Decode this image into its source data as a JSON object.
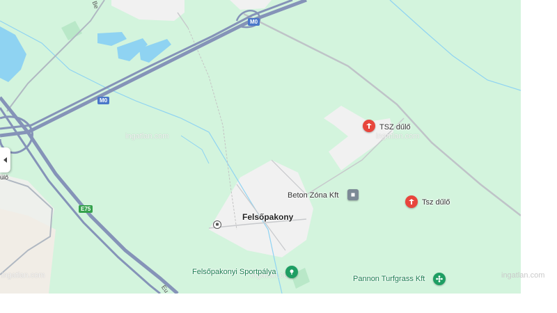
{
  "map": {
    "places": {
      "town": "Felsőpakony",
      "partial_road": "Be",
      "partial_left": "ülő",
      "road_eu": "Eu"
    },
    "road_shields": {
      "m0_top": "M0",
      "m0_mid": "M0",
      "e75": "E75"
    },
    "pois": [
      {
        "name": "TSZ dűlő",
        "icon": "pin-red-icon"
      },
      {
        "name": "Tsz dűlő",
        "icon": "pin-red-icon"
      },
      {
        "name": "Beton Zóna Kft",
        "icon": "business-square-icon"
      },
      {
        "name": "Felsőpakonyi Sportpálya",
        "icon": "sports-pin-icon"
      },
      {
        "name": "Pannon Turfgrass Kft",
        "icon": "flower-pin-icon"
      }
    ],
    "watermarks": [
      "ingatlan.com",
      "ingatlan.com",
      "ingatlan.com",
      "ingatlan.com",
      "ingatlan.com"
    ],
    "colors": {
      "land": "#d3f4dd",
      "water": "#8fd3f2",
      "motorway": "#8593b8",
      "urban": "#f1f1f1",
      "poi_red": "#e8453c",
      "poi_green": "#1e9e63"
    }
  }
}
